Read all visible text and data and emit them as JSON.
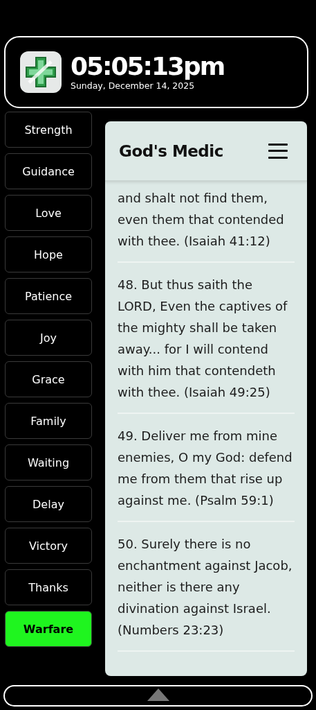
{
  "header": {
    "time": "05:05:13pm",
    "date": "Sunday, December 14, 2025"
  },
  "sidebar": {
    "items": [
      {
        "label": "Strength",
        "selected": false
      },
      {
        "label": "Guidance",
        "selected": false
      },
      {
        "label": "Love",
        "selected": false
      },
      {
        "label": "Hope",
        "selected": false
      },
      {
        "label": "Patience",
        "selected": false
      },
      {
        "label": "Joy",
        "selected": false
      },
      {
        "label": "Grace",
        "selected": false
      },
      {
        "label": "Family",
        "selected": false
      },
      {
        "label": "Waiting",
        "selected": false
      },
      {
        "label": "Delay",
        "selected": false
      },
      {
        "label": "Victory",
        "selected": false
      },
      {
        "label": "Thanks",
        "selected": false
      },
      {
        "label": "Warfare",
        "selected": true
      }
    ]
  },
  "panel": {
    "title": "God's Medic",
    "verses": [
      "and shalt not find them, even them that contended with thee. (Isaiah 41:12)",
      "48. But thus saith the LORD, Even the captives of the mighty shall be taken away... for I will contend with him that contendeth with thee. (Isaiah 49:25)",
      "49. Deliver me from mine enemies, O my God: defend me from them that rise up against me. (Psalm 59:1)",
      "50. Surely there is no enchantment against Jacob, neither is there any divination against Israel. (Numbers 23:23)"
    ]
  }
}
